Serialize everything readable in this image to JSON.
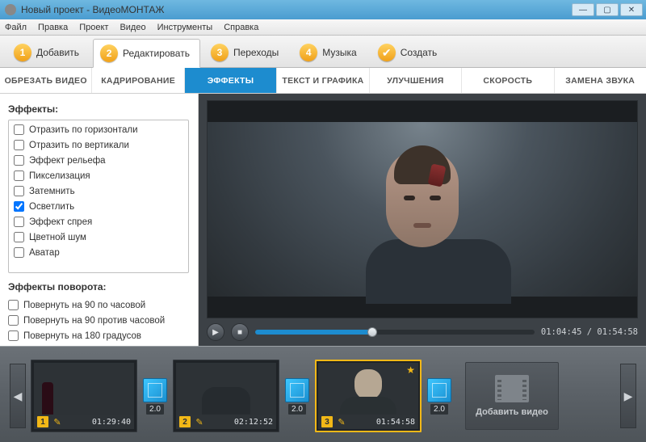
{
  "window": {
    "title": "Новый проект - ВидеоМОНТАЖ"
  },
  "menu": {
    "file": "Файл",
    "edit": "Правка",
    "project": "Проект",
    "video": "Видео",
    "tools": "Инструменты",
    "help": "Справка"
  },
  "steps": {
    "s1": "Добавить",
    "s2": "Редактировать",
    "s3": "Переходы",
    "s4": "Музыка",
    "s5": "Создать"
  },
  "subtabs": {
    "trim": "ОБРЕЗАТЬ ВИДЕО",
    "crop": "КАДРИРОВАНИЕ",
    "effects": "ЭФФЕКТЫ",
    "text": "ТЕКСТ И ГРАФИКА",
    "enhance": "УЛУЧШЕНИЯ",
    "speed": "СКОРОСТЬ",
    "audio": "ЗАМЕНА ЗВУКА"
  },
  "panel": {
    "effects_hdr": "Эффекты:",
    "rotation_hdr": "Эффекты поворота:",
    "effects": {
      "flip_h": "Отразить по горизонтали",
      "flip_v": "Отразить по вертикали",
      "relief": "Эффект рельефа",
      "pixel": "Пикселизация",
      "darken": "Затемнить",
      "lighten": "Осветлить",
      "spray": "Эффект спрея",
      "noise": "Цветной шум",
      "avatar": "Аватар"
    },
    "rotation": {
      "cw90": "Повернуть на 90 по часовой",
      "ccw90": "Повернуть на 90 против часовой",
      "r180": "Повернуть на 180 градусов"
    }
  },
  "player": {
    "time": "01:04:45 / 01:54:58"
  },
  "timeline": {
    "add_label": "Добавить видео",
    "trans_dur": "2.0",
    "clips": [
      {
        "idx": "1",
        "dur": "01:29:40"
      },
      {
        "idx": "2",
        "dur": "02:12:52"
      },
      {
        "idx": "3",
        "dur": "01:54:58"
      }
    ]
  }
}
